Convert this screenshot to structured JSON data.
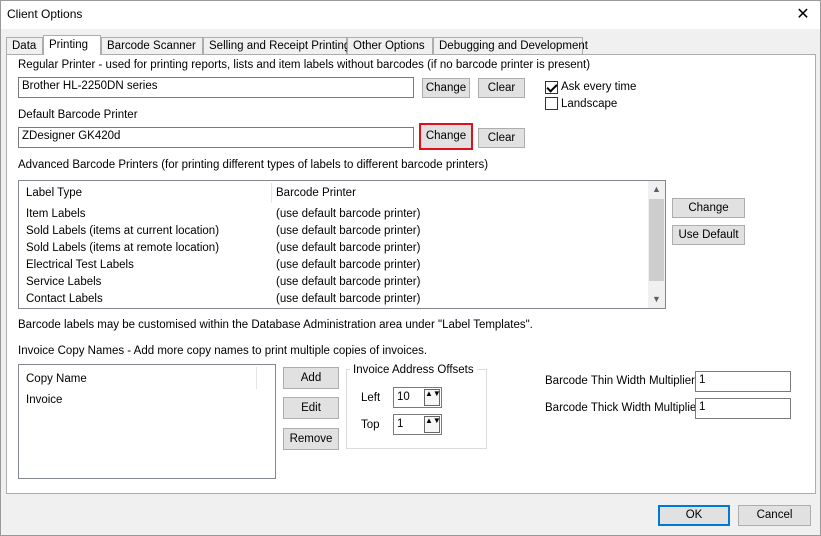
{
  "window": {
    "title": "Client Options",
    "close_glyph": "✕"
  },
  "tabs": [
    {
      "label": "Data"
    },
    {
      "label": "Printing"
    },
    {
      "label": "Barcode Scanner"
    },
    {
      "label": "Selling and Receipt Printing"
    },
    {
      "label": "Other Options"
    },
    {
      "label": "Debugging and Development"
    }
  ],
  "regular_printer": {
    "label": "Regular Printer - used for printing reports, lists and item labels without barcodes (if no barcode printer is present)",
    "value": "Brother HL-2250DN series",
    "change": "Change",
    "clear": "Clear",
    "ask_every_time": "Ask every time",
    "ask_checked": true,
    "landscape": "Landscape",
    "landscape_checked": false
  },
  "default_barcode": {
    "label": "Default Barcode Printer",
    "value": "ZDesigner GK420d",
    "change": "Change",
    "clear": "Clear"
  },
  "advanced": {
    "label": "Advanced Barcode Printers (for printing different types of labels to different barcode printers)",
    "columns": [
      "Label Type",
      "Barcode Printer"
    ],
    "rows": [
      [
        "Item Labels",
        "(use default barcode printer)"
      ],
      [
        "Sold Labels (items at current location)",
        "(use default barcode printer)"
      ],
      [
        "Sold Labels (items at remote location)",
        "(use default barcode printer)"
      ],
      [
        "Electrical Test Labels",
        "(use default barcode printer)"
      ],
      [
        "Service Labels",
        "(use default barcode printer)"
      ],
      [
        "Contact Labels",
        "(use default barcode printer)"
      ]
    ],
    "change": "Change",
    "use_default": "Use Default"
  },
  "note": "Barcode labels may be customised within the Database Administration area under \"Label Templates\".",
  "invoice": {
    "label": "Invoice Copy Names - Add more copy names to print multiple copies of invoices.",
    "column": "Copy Name",
    "rows": [
      "Invoice"
    ],
    "add": "Add",
    "edit": "Edit",
    "remove": "Remove"
  },
  "offsets": {
    "label": "Invoice Address Offsets",
    "left_label": "Left",
    "left_value": "10",
    "top_label": "Top",
    "top_value": "1"
  },
  "multipliers": {
    "thin_label": "Barcode Thin Width Multiplier",
    "thin_value": "1",
    "thick_label": "Barcode Thick Width Multiplier",
    "thick_value": "1"
  },
  "footer": {
    "ok": "OK",
    "cancel": "Cancel"
  },
  "icons": {
    "up": "▲",
    "down": "▼",
    "spin": "▲▼"
  }
}
